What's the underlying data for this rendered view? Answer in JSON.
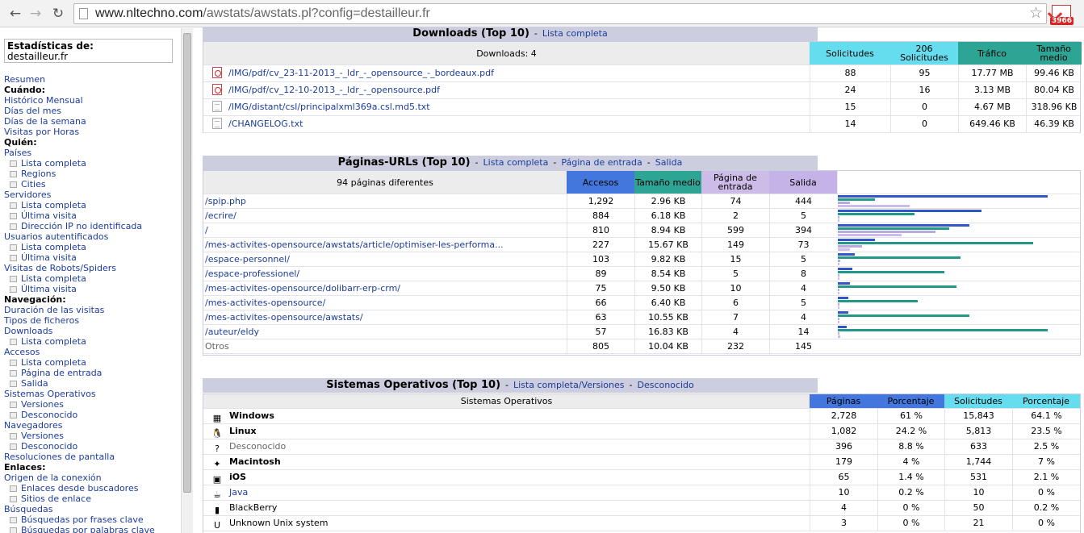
{
  "browser": {
    "url_host": "www.nltechno.com",
    "url_path": "/awstats/awstats.pl?config=destailleur.fr",
    "gmail_count": "3966"
  },
  "sidebar": {
    "box_title": "Estadísticas de:",
    "box_site": "destailleur.fr",
    "items": [
      {
        "t": "lnk",
        "label": "Resumen"
      },
      {
        "t": "hdr",
        "label": "Cuándo:"
      },
      {
        "t": "lnk",
        "label": "Histórico Mensual"
      },
      {
        "t": "lnk",
        "label": "Días del mes"
      },
      {
        "t": "lnk",
        "label": "Días de la semana"
      },
      {
        "t": "lnk",
        "label": "Visitas por Horas"
      },
      {
        "t": "hdr",
        "label": "Quién:"
      },
      {
        "t": "lnk",
        "label": "Países"
      },
      {
        "t": "sub",
        "label": "Lista completa"
      },
      {
        "t": "sub",
        "label": "Regions"
      },
      {
        "t": "sub",
        "label": "Cities"
      },
      {
        "t": "lnk",
        "label": "Servidores"
      },
      {
        "t": "sub",
        "label": "Lista completa"
      },
      {
        "t": "sub",
        "label": "Última visita"
      },
      {
        "t": "sub",
        "label": "Dirección IP no identificada"
      },
      {
        "t": "lnk",
        "label": "Usuarios autentificados"
      },
      {
        "t": "sub",
        "label": "Lista completa"
      },
      {
        "t": "sub",
        "label": "Última visita"
      },
      {
        "t": "lnk",
        "label": "Visitas de Robots/Spiders"
      },
      {
        "t": "sub",
        "label": "Lista completa"
      },
      {
        "t": "sub",
        "label": "Última visita"
      },
      {
        "t": "hdr",
        "label": "Navegación:"
      },
      {
        "t": "lnk",
        "label": "Duración de las visitas"
      },
      {
        "t": "lnk",
        "label": "Tipos de ficheros"
      },
      {
        "t": "lnk",
        "label": "Downloads"
      },
      {
        "t": "sub",
        "label": "Lista completa"
      },
      {
        "t": "lnk",
        "label": "Accesos"
      },
      {
        "t": "sub",
        "label": "Lista completa"
      },
      {
        "t": "sub",
        "label": "Página de entrada"
      },
      {
        "t": "sub",
        "label": "Salida"
      },
      {
        "t": "lnk",
        "label": "Sistemas Operativos"
      },
      {
        "t": "sub",
        "label": "Versiones"
      },
      {
        "t": "sub",
        "label": "Desconocido"
      },
      {
        "t": "lnk",
        "label": "Navegadores"
      },
      {
        "t": "sub",
        "label": "Versiones"
      },
      {
        "t": "sub",
        "label": "Desconocido"
      },
      {
        "t": "lnk",
        "label": "Resoluciones de pantalla"
      },
      {
        "t": "hdr",
        "label": "Enlaces:"
      },
      {
        "t": "lnk",
        "label": "Origen de la conexión"
      },
      {
        "t": "sub",
        "label": "Enlaces desde buscadores"
      },
      {
        "t": "sub",
        "label": "Sitios de enlace"
      },
      {
        "t": "lnk",
        "label": "Búsquedas"
      },
      {
        "t": "sub",
        "label": "Búsquedas por frases clave"
      },
      {
        "t": "sub",
        "label": "Búsquedas por palabras clave"
      }
    ]
  },
  "downloads": {
    "title": "Downloads (Top 10)",
    "dash": "-",
    "link_full": "Lista completa",
    "summary": "Downloads: 4",
    "headers": [
      "Solicitudes",
      "206 Solicitudes",
      "Tráfico",
      "Tamaño medio"
    ],
    "colors": {
      "solicitudes": "#66ddee",
      "s206": "#66ddee",
      "trafico": "#2ea495",
      "medio": "#2ea495"
    },
    "rows": [
      {
        "icon": "pdf",
        "path": "/IMG/pdf/cv_23-11-2013_-_ldr_-_opensource_-_bordeaux.pdf",
        "req": "88",
        "r206": "95",
        "traffic": "17.77 MB",
        "avg": "99.46 KB"
      },
      {
        "icon": "pdf",
        "path": "/IMG/pdf/cv_12-10-2013_-_ldr_-_opensource.pdf",
        "req": "24",
        "r206": "16",
        "traffic": "3.13 MB",
        "avg": "80.04 KB"
      },
      {
        "icon": "txt",
        "path": "/IMG/distant/csl/principalxml369a.csl.md5.txt",
        "req": "15",
        "r206": "0",
        "traffic": "4.67 MB",
        "avg": "318.96 KB"
      },
      {
        "icon": "txt",
        "path": "/CHANGELOG.txt",
        "req": "14",
        "r206": "0",
        "traffic": "649.46 KB",
        "avg": "46.39 KB"
      }
    ]
  },
  "pages": {
    "title": "Páginas-URLs (Top 10)",
    "dash": "-",
    "link_full": "Lista completa",
    "link_entry": "Página de entrada",
    "link_exit": "Salida",
    "summary": "94 páginas diferentes",
    "headers": [
      "Accesos",
      "Tamaño medio",
      "Página de entrada",
      "Salida"
    ],
    "colors": {
      "accesos": "#4477dd",
      "tamano": "#2ea495",
      "entrada": "#cebce8",
      "salida": "#c5b2e6"
    },
    "bar_colors": {
      "accesos": "#3355cc",
      "tamano": "#229988",
      "entrada": "#bba8e0",
      "salida": "#ccbbee"
    },
    "rows": [
      {
        "url": "/spip.php",
        "hits": "1,292",
        "size": "2.96 KB",
        "entry": "74",
        "exit": "444",
        "b": [
          1292,
          2.96,
          74,
          444
        ]
      },
      {
        "url": "/ecrire/",
        "hits": "884",
        "size": "6.18 KB",
        "entry": "2",
        "exit": "5",
        "b": [
          884,
          6.18,
          2,
          5
        ]
      },
      {
        "url": "/",
        "hits": "810",
        "size": "8.94 KB",
        "entry": "599",
        "exit": "394",
        "b": [
          810,
          8.94,
          599,
          394
        ]
      },
      {
        "url": "/mes-activites-opensource/awstats/article/optimiser-les-performa...",
        "hits": "227",
        "size": "15.67 KB",
        "entry": "149",
        "exit": "73",
        "b": [
          227,
          15.67,
          149,
          73
        ]
      },
      {
        "url": "/espace-personnel/",
        "hits": "103",
        "size": "9.82 KB",
        "entry": "15",
        "exit": "5",
        "b": [
          103,
          9.82,
          15,
          5
        ]
      },
      {
        "url": "/espace-professionel/",
        "hits": "89",
        "size": "8.54 KB",
        "entry": "5",
        "exit": "8",
        "b": [
          89,
          8.54,
          5,
          8
        ]
      },
      {
        "url": "/mes-activites-opensource/dolibarr-erp-crm/",
        "hits": "75",
        "size": "9.50 KB",
        "entry": "10",
        "exit": "4",
        "b": [
          75,
          9.5,
          10,
          4
        ]
      },
      {
        "url": "/mes-activites-opensource/",
        "hits": "66",
        "size": "6.40 KB",
        "entry": "6",
        "exit": "5",
        "b": [
          66,
          6.4,
          6,
          5
        ]
      },
      {
        "url": "/mes-activites-opensource/awstats/",
        "hits": "63",
        "size": "10.55 KB",
        "entry": "7",
        "exit": "4",
        "b": [
          63,
          10.55,
          7,
          4
        ]
      },
      {
        "url": "/auteur/eldy",
        "hits": "57",
        "size": "16.83 KB",
        "entry": "4",
        "exit": "14",
        "b": [
          57,
          16.83,
          4,
          14
        ]
      }
    ],
    "other": {
      "label": "Otros",
      "hits": "805",
      "size": "10.04 KB",
      "entry": "232",
      "exit": "145"
    }
  },
  "os": {
    "title": "Sistemas Operativos (Top 10)",
    "dash": "-",
    "link_full": "Lista completa/Versiones",
    "link_unknown": "Desconocido",
    "col_label": "Sistemas Operativos",
    "headers": [
      "Páginas",
      "Porcentaje",
      "Solicitudes",
      "Porcentaje"
    ],
    "colors": {
      "paginas": "#4477dd",
      "pct1": "#4477dd",
      "solicitudes": "#66ddee",
      "pct2": "#66ddee"
    },
    "rows": [
      {
        "icon": "windows-icon",
        "glyph": "▦",
        "name": "Windows",
        "bold": true,
        "style": "bold",
        "pages": "2,728",
        "p1": "61 %",
        "req": "15,843",
        "p2": "64.1 %"
      },
      {
        "icon": "linux-icon",
        "glyph": "🐧",
        "name": "Linux",
        "bold": true,
        "style": "bold",
        "pages": "1,082",
        "p1": "24.2 %",
        "req": "5,813",
        "p2": "23.5 %"
      },
      {
        "icon": "unknown-icon",
        "glyph": "?",
        "name": "Desconocido",
        "bold": false,
        "style": "gray",
        "pages": "396",
        "p1": "8.8 %",
        "req": "633",
        "p2": "2.5 %"
      },
      {
        "icon": "macintosh-icon",
        "glyph": "✦",
        "name": "Macintosh",
        "bold": true,
        "style": "bold",
        "pages": "179",
        "p1": "4 %",
        "req": "1,744",
        "p2": "7 %"
      },
      {
        "icon": "ios-icon",
        "glyph": "▣",
        "name": "iOS",
        "bold": true,
        "style": "bold",
        "pages": "65",
        "p1": "1.4 %",
        "req": "531",
        "p2": "2.1 %"
      },
      {
        "icon": "java-icon",
        "glyph": "☕",
        "name": "Java",
        "bold": false,
        "style": "link",
        "pages": "10",
        "p1": "0.2 %",
        "req": "10",
        "p2": "0 %"
      },
      {
        "icon": "blackberry-icon",
        "glyph": "▮",
        "name": "BlackBerry",
        "bold": false,
        "style": "plain",
        "pages": "4",
        "p1": "0 %",
        "req": "50",
        "p2": "0.2 %"
      },
      {
        "icon": "unix-icon",
        "glyph": "U",
        "name": "Unknown Unix system",
        "bold": false,
        "style": "plain",
        "pages": "3",
        "p1": "0 %",
        "req": "21",
        "p2": "0 %"
      }
    ]
  }
}
